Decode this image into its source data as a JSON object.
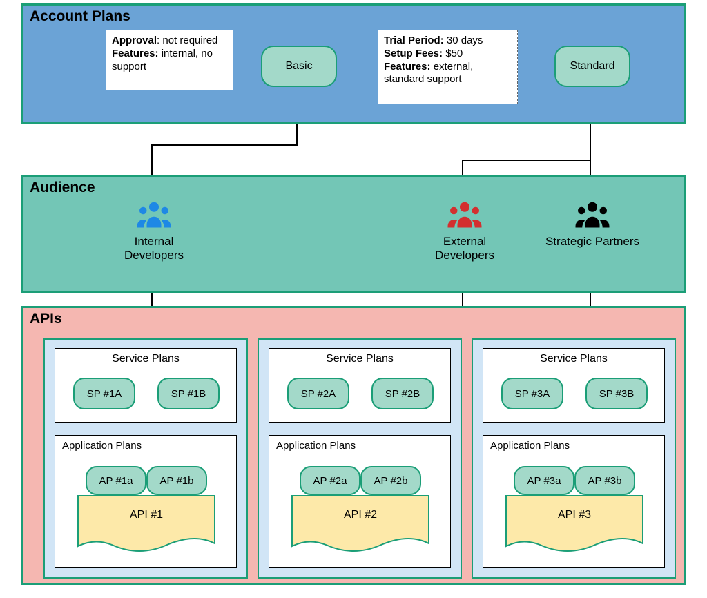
{
  "sections": {
    "account_plans": "Account Plans",
    "audience": "Audience",
    "apis": "APIs"
  },
  "plans": {
    "basic": {
      "label": "Basic",
      "approval_key": "Approval",
      "approval_val": ": not required",
      "features_key": "Features:",
      "features_val": " internal, no support"
    },
    "standard": {
      "label": "Standard",
      "trial_key": "Trial Period:",
      "trial_val": " 30 days",
      "setup_key": "Setup Fees:",
      "setup_val": " $50",
      "features_key": "Features:",
      "features_val": " external, standard support"
    }
  },
  "audience": {
    "internal": "Internal Developers",
    "external": "External Developers",
    "partners": "Strategic Partners"
  },
  "api_blocks": [
    {
      "service_title": "Service Plans",
      "sp_a": "SP #1A",
      "sp_b": "SP #1B",
      "app_title": "Application Plans",
      "ap_a": "AP #1a",
      "ap_b": "AP #1b",
      "api_label": "API #1"
    },
    {
      "service_title": "Service Plans",
      "sp_a": "SP #2A",
      "sp_b": "SP #2B",
      "app_title": "Application Plans",
      "ap_a": "AP #2a",
      "ap_b": "AP #2b",
      "api_label": "API #2"
    },
    {
      "service_title": "Service Plans",
      "sp_a": "SP #3A",
      "sp_b": "SP #3B",
      "app_title": "Application Plans",
      "ap_a": "AP #3a",
      "ap_b": "AP #3b",
      "api_label": "API #3"
    }
  ],
  "chart_data": {
    "type": "diagram",
    "title": "Account Plans / Audience / APIs relationship",
    "nodes": {
      "account_plans": [
        "Basic",
        "Standard"
      ],
      "audiences": [
        "Internal Developers",
        "External Developers",
        "Strategic Partners"
      ],
      "apis": [
        "API #1",
        "API #2",
        "API #3"
      ]
    },
    "plan_details": {
      "Basic": {
        "approval": "not required",
        "features": "internal, no support"
      },
      "Standard": {
        "trial_period": "30 days",
        "setup_fees": "$50",
        "features": "external, standard support"
      }
    },
    "service_plans": {
      "API #1": [
        "SP #1A",
        "SP #1B"
      ],
      "API #2": [
        "SP #2A",
        "SP #2B"
      ],
      "API #3": [
        "SP #3A",
        "SP #3B"
      ]
    },
    "application_plans": {
      "API #1": [
        "AP #1a",
        "AP #1b"
      ],
      "API #2": [
        "AP #2a",
        "AP #2b"
      ],
      "API #3": [
        "AP #3a",
        "AP #3b"
      ]
    },
    "edges": [
      [
        "Basic",
        "Internal Developers"
      ],
      [
        "Standard",
        "External Developers"
      ],
      [
        "Standard",
        "Strategic Partners"
      ],
      [
        "Internal Developers",
        "API #1"
      ],
      [
        "External Developers",
        "API #2"
      ],
      [
        "Strategic Partners",
        "API #3"
      ]
    ]
  }
}
